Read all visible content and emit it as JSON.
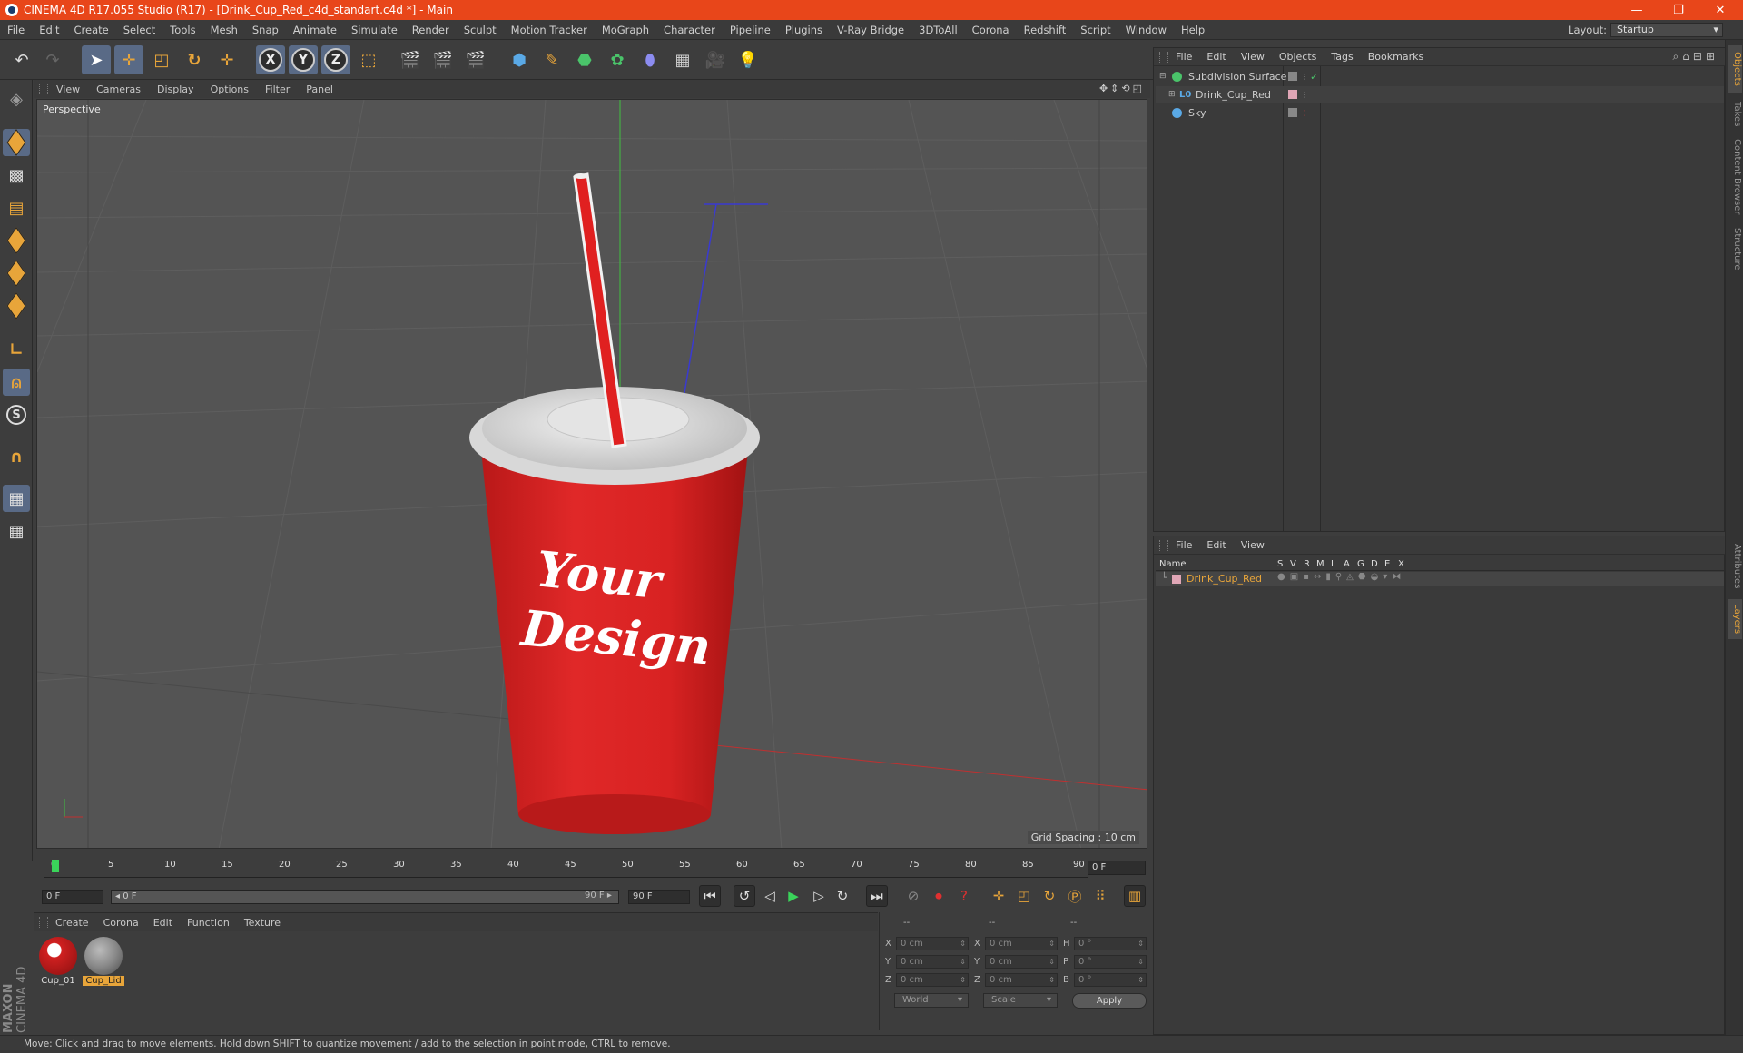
{
  "window": {
    "title": "CINEMA 4D R17.055 Studio (R17) - [Drink_Cup_Red_c4d_standart.c4d *] - Main",
    "controls": [
      "—",
      "❐",
      "✕"
    ]
  },
  "menu": [
    "File",
    "Edit",
    "Create",
    "Select",
    "Tools",
    "Mesh",
    "Snap",
    "Animate",
    "Simulate",
    "Render",
    "Sculpt",
    "Motion Tracker",
    "MoGraph",
    "Character",
    "Pipeline",
    "Plugins",
    "V-Ray Bridge",
    "3DToAll",
    "Corona",
    "Redshift",
    "Script",
    "Window",
    "Help"
  ],
  "layout": {
    "label": "Layout:",
    "value": "Startup"
  },
  "axes": [
    "X",
    "Y",
    "Z"
  ],
  "viewport": {
    "menu": [
      "View",
      "Cameras",
      "Display",
      "Options",
      "Filter",
      "Panel"
    ],
    "label": "Perspective",
    "grid_spacing": "Grid Spacing : 10 cm",
    "cup_text": [
      "Your",
      "Design"
    ]
  },
  "timeline": {
    "ticks": [
      "0",
      "5",
      "10",
      "15",
      "20",
      "25",
      "30",
      "35",
      "40",
      "45",
      "50",
      "55",
      "60",
      "65",
      "70",
      "75",
      "80",
      "85",
      "90"
    ],
    "current_frame": "0 F",
    "start": "0 F",
    "slider_start": "◂ 0 F",
    "slider_end": "90 F ▸",
    "end": "90 F"
  },
  "materials": {
    "menu": [
      "Create",
      "Corona",
      "Edit",
      "Function",
      "Texture"
    ],
    "items": [
      {
        "name": "Cup_01"
      },
      {
        "name": "Cup_Lid"
      }
    ]
  },
  "coords": {
    "header": [
      "--",
      "--",
      "--"
    ],
    "rows": [
      {
        "a": "X",
        "av": "0 cm",
        "b": "X",
        "bv": "0 cm",
        "c": "H",
        "cv": "0 °"
      },
      {
        "a": "Y",
        "av": "0 cm",
        "b": "Y",
        "bv": "0 cm",
        "c": "P",
        "cv": "0 °"
      },
      {
        "a": "Z",
        "av": "0 cm",
        "b": "Z",
        "bv": "0 cm",
        "c": "B",
        "cv": "0 °"
      }
    ],
    "world": "World",
    "scale": "Scale",
    "apply": "Apply"
  },
  "objects": {
    "menu": [
      "File",
      "Edit",
      "View",
      "Objects",
      "Tags",
      "Bookmarks"
    ],
    "items": [
      {
        "name": "Subdivision Surface"
      },
      {
        "name": "Drink_Cup_Red"
      },
      {
        "name": "Sky"
      }
    ]
  },
  "layers": {
    "menu": [
      "File",
      "Edit",
      "View"
    ],
    "columns": [
      "Name",
      "S",
      "V",
      "R",
      "M",
      "L",
      "A",
      "G",
      "D",
      "E",
      "X"
    ],
    "row": "Drink_Cup_Red"
  },
  "right_tabs": [
    "Objects",
    "Takes",
    "Content Browser",
    "Structure",
    "Attributes",
    "Layers"
  ],
  "status": "Move: Click and drag to move elements. Hold down SHIFT to quantize movement / add to the selection in point mode, CTRL to remove.",
  "brand": [
    "MAXON",
    "CINEMA 4D"
  ]
}
